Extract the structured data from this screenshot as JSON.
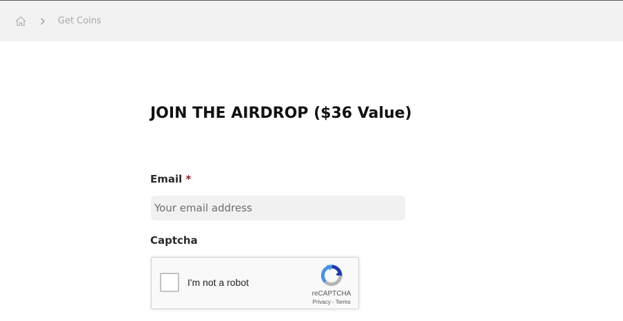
{
  "breadcrumb": {
    "home_icon": "home-icon",
    "separator_icon": "chevron-right-icon",
    "current": "Get Coins"
  },
  "page": {
    "title": "JOIN THE AIRDROP ($36 Value)"
  },
  "form": {
    "email_label": "Email",
    "required_marker": "*",
    "email_placeholder": "Your email address",
    "email_value": "",
    "captcha_label": "Captcha"
  },
  "recaptcha": {
    "checkbox_label": "I'm not a robot",
    "brand": "reCAPTCHA",
    "privacy": "Privacy",
    "separator": " - ",
    "terms": "Terms",
    "logo_icon": "recaptcha-logo-icon"
  },
  "colors": {
    "breadcrumb_bg": "#f2f2f2",
    "required": "#8b1a1a",
    "input_bg": "#f1f1f1",
    "recaptcha_blue": "#4a90e2",
    "recaptcha_gray": "#b5b5b5"
  }
}
